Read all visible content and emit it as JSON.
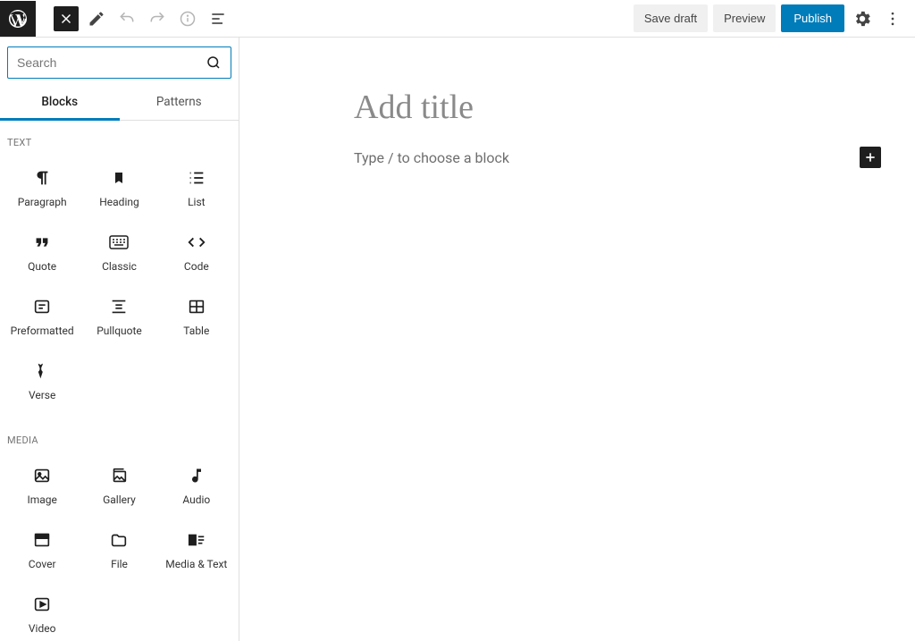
{
  "topbar": {
    "save_draft": "Save draft",
    "preview": "Preview",
    "publish": "Publish"
  },
  "inserter": {
    "search_placeholder": "Search",
    "tabs": {
      "blocks": "Blocks",
      "patterns": "Patterns"
    },
    "categories": [
      {
        "label": "TEXT",
        "blocks": [
          {
            "name": "Paragraph",
            "icon": "paragraph"
          },
          {
            "name": "Heading",
            "icon": "heading"
          },
          {
            "name": "List",
            "icon": "list"
          },
          {
            "name": "Quote",
            "icon": "quote"
          },
          {
            "name": "Classic",
            "icon": "classic"
          },
          {
            "name": "Code",
            "icon": "code"
          },
          {
            "name": "Preformatted",
            "icon": "preformatted"
          },
          {
            "name": "Pullquote",
            "icon": "pullquote"
          },
          {
            "name": "Table",
            "icon": "table"
          },
          {
            "name": "Verse",
            "icon": "verse"
          }
        ]
      },
      {
        "label": "MEDIA",
        "blocks": [
          {
            "name": "Image",
            "icon": "image"
          },
          {
            "name": "Gallery",
            "icon": "gallery"
          },
          {
            "name": "Audio",
            "icon": "audio"
          },
          {
            "name": "Cover",
            "icon": "cover"
          },
          {
            "name": "File",
            "icon": "file"
          },
          {
            "name": "Media & Text",
            "icon": "mediatext"
          },
          {
            "name": "Video",
            "icon": "video"
          }
        ]
      }
    ]
  },
  "editor": {
    "title_placeholder": "Add title",
    "block_hint": "Type / to choose a block"
  }
}
